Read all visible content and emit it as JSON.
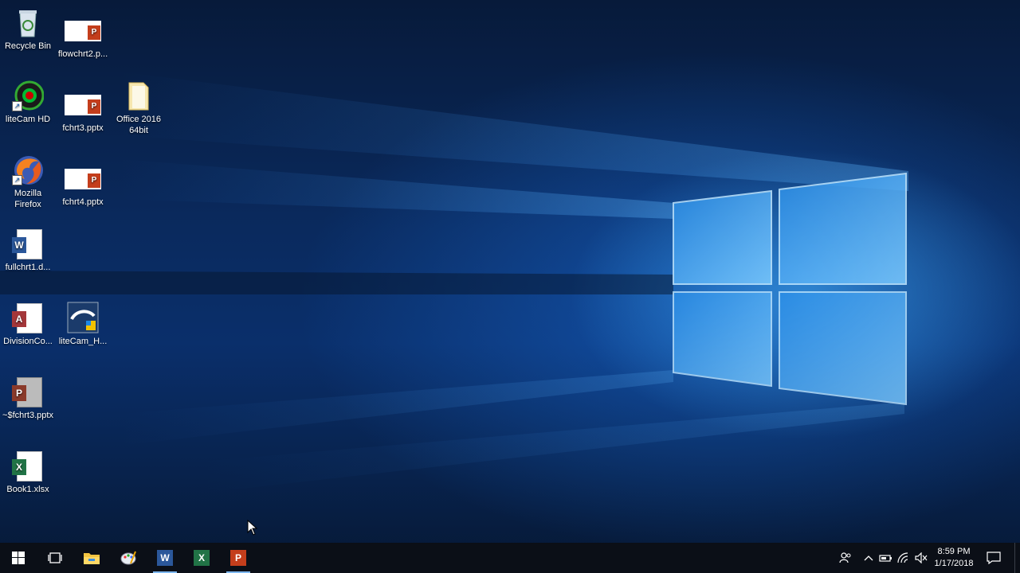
{
  "desktop": {
    "icons": [
      {
        "label": "Recycle Bin"
      },
      {
        "label": "flowchrt2.p..."
      },
      {
        "label": "liteCam HD"
      },
      {
        "label": "fchrt3.pptx"
      },
      {
        "label": "Office 2016 64bit"
      },
      {
        "label": "Mozilla Firefox"
      },
      {
        "label": "fchrt4.pptx"
      },
      {
        "label": "fullchrt1.d..."
      },
      {
        "label": "DivisionCo..."
      },
      {
        "label": "liteCam_H..."
      },
      {
        "label": "~$fchrt3.pptx"
      },
      {
        "label": "Book1.xlsx"
      }
    ]
  },
  "taskbar": {
    "pinned": [
      {
        "icon": "windows-start-icon"
      },
      {
        "icon": "task-view-icon"
      },
      {
        "icon": "file-explorer-icon"
      },
      {
        "icon": "paint-app-icon"
      },
      {
        "icon": "word-icon",
        "badge": "W"
      },
      {
        "icon": "excel-icon",
        "badge": "X"
      },
      {
        "icon": "powerpoint-icon",
        "badge": "P"
      }
    ],
    "clock": {
      "time": "8:59 PM",
      "date": "1/17/2018"
    }
  },
  "colors": {
    "word": "#2b579a",
    "excel": "#217346",
    "powerpoint": "#c43e1c",
    "access": "#a4373a",
    "taskbar": "#0b0f17"
  }
}
